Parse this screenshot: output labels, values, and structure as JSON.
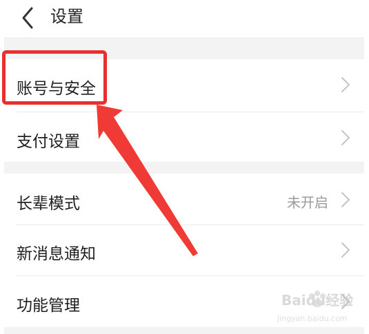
{
  "header": {
    "back_icon": "chevron-left-icon",
    "title": "设置"
  },
  "settings": {
    "items": [
      {
        "label": "账号与安全",
        "value": "",
        "icon": "chevron-right-icon"
      },
      {
        "label": "支付设置",
        "value": "",
        "icon": "chevron-right-icon"
      },
      {
        "label": "长辈模式",
        "value": "未开启",
        "icon": "chevron-right-icon"
      },
      {
        "label": "新消息通知",
        "value": "",
        "icon": "chevron-right-icon"
      },
      {
        "label": "功能管理",
        "value": "",
        "icon": "chevron-right-icon"
      }
    ]
  },
  "annotation": {
    "highlight_color": "#e8312f"
  },
  "watermark": {
    "text": "Baidu经验",
    "url": "jingyan.baidu.com"
  }
}
